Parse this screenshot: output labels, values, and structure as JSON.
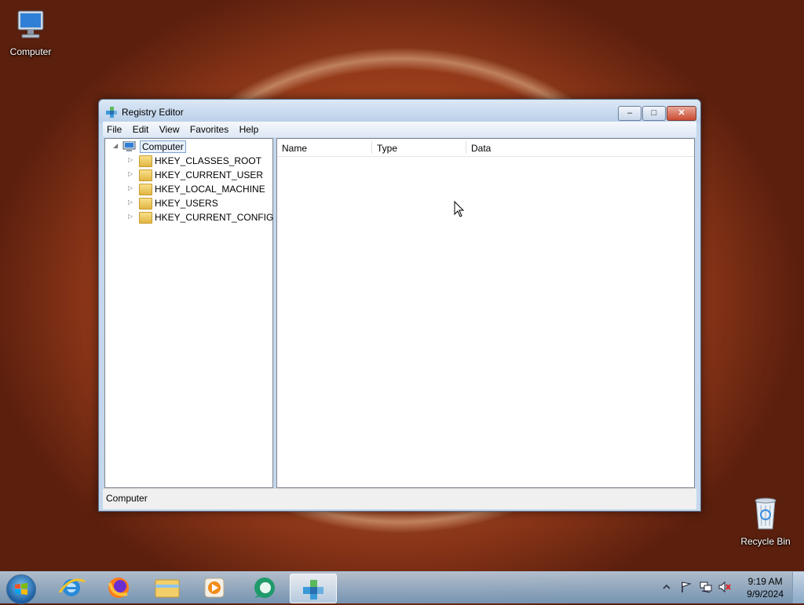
{
  "desktop": {
    "icons": [
      {
        "label": "Computer"
      },
      {
        "label": "Recycle Bin"
      }
    ]
  },
  "window": {
    "title": "Registry Editor",
    "controls": {
      "minimize": "–",
      "maximize": "□",
      "close": "✕"
    },
    "menu": [
      "File",
      "Edit",
      "View",
      "Favorites",
      "Help"
    ],
    "tree": {
      "root": "Computer",
      "children": [
        "HKEY_CLASSES_ROOT",
        "HKEY_CURRENT_USER",
        "HKEY_LOCAL_MACHINE",
        "HKEY_USERS",
        "HKEY_CURRENT_CONFIG"
      ]
    },
    "list": {
      "columns": [
        "Name",
        "Type",
        "Data"
      ]
    },
    "status": "Computer"
  },
  "taskbar": {
    "pinned": [
      "start-button",
      "internet-explorer",
      "firefox",
      "file-explorer",
      "media-player",
      "app-green",
      "registry-editor"
    ],
    "clock": {
      "time": "9:19 AM",
      "date": "9/9/2024"
    }
  },
  "colors": {
    "accent": "#1b5da0",
    "selection_border": "#7da2ce"
  }
}
